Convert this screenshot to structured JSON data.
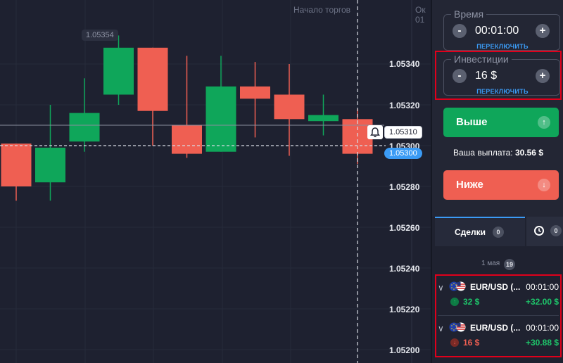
{
  "colors": {
    "up": "#0fa65a",
    "down": "#ef5f52",
    "accent": "#3b9bf5",
    "highlight_box": "#e0001b"
  },
  "chart": {
    "top_labels": [
      "Начало торгов",
      "Ок",
      "01"
    ],
    "high_tag": "1.05354",
    "price_axis": [
      "1.05340",
      "1.05320",
      "1.05300",
      "1.05280",
      "1.05260",
      "1.05240",
      "1.05220",
      "1.05200"
    ],
    "current_line_tag": "1.05310",
    "current_price_tag": "1.05300",
    "alert_icon": "bell-icon",
    "candles": [
      {
        "direction": "down",
        "open": 1.05301,
        "high": 1.05301,
        "low": 1.05273,
        "close": 1.0528
      },
      {
        "direction": "up",
        "open": 1.05282,
        "high": 1.0532,
        "low": 1.05273,
        "close": 1.05299
      },
      {
        "direction": "up",
        "open": 1.05302,
        "high": 1.05333,
        "low": 1.05297,
        "close": 1.05316
      },
      {
        "direction": "up",
        "open": 1.05325,
        "high": 1.05354,
        "low": 1.0532,
        "close": 1.05348
      },
      {
        "direction": "down",
        "open": 1.05348,
        "high": 1.05348,
        "low": 1.053,
        "close": 1.05317
      },
      {
        "direction": "down",
        "open": 1.0531,
        "high": 1.05344,
        "low": 1.05294,
        "close": 1.05296
      },
      {
        "direction": "up",
        "open": 1.05297,
        "high": 1.05344,
        "low": 1.05297,
        "close": 1.05329
      },
      {
        "direction": "down",
        "open": 1.05329,
        "high": 1.05341,
        "low": 1.05304,
        "close": 1.05323
      },
      {
        "direction": "down",
        "open": 1.05325,
        "high": 1.0534,
        "low": 1.05295,
        "close": 1.05313
      },
      {
        "direction": "up",
        "open": 1.05312,
        "high": 1.05325,
        "low": 1.05305,
        "close": 1.05315
      },
      {
        "direction": "down",
        "open": 1.05313,
        "high": 1.05318,
        "low": 1.05291,
        "close": 1.05296
      }
    ]
  },
  "panel": {
    "time": {
      "legend": "Время",
      "value": "00:01:00",
      "minus": "-",
      "plus": "+",
      "switch": "ПЕРЕКЛЮЧИТЬ"
    },
    "investment": {
      "legend": "Инвестиции",
      "value": "16 $",
      "minus": "-",
      "plus": "+",
      "switch": "ПЕРЕКЛЮЧИТЬ"
    },
    "higher": {
      "label": "Выше",
      "icon": "arrow-up-icon"
    },
    "payout": {
      "label": "Ваша выплата:",
      "value": "30.56 $"
    },
    "lower": {
      "label": "Ниже",
      "icon": "arrow-down-icon"
    },
    "tabs": {
      "trades_label": "Сделки",
      "trades_count": "0",
      "history_icon": "clock-icon",
      "history_count": "0"
    },
    "date": {
      "label": "1 мая",
      "count": "19"
    },
    "trades": [
      {
        "pair": "EUR/USD (...",
        "duration": "00:01:00",
        "direction": "up",
        "amount": "32 $",
        "profit": "+32.00 $",
        "flag_icon": "eu-us-flag-icon"
      },
      {
        "pair": "EUR/USD (...",
        "duration": "00:01:00",
        "direction": "down",
        "amount": "16 $",
        "profit": "+30.88 $",
        "flag_icon": "eu-us-flag-icon"
      }
    ]
  }
}
